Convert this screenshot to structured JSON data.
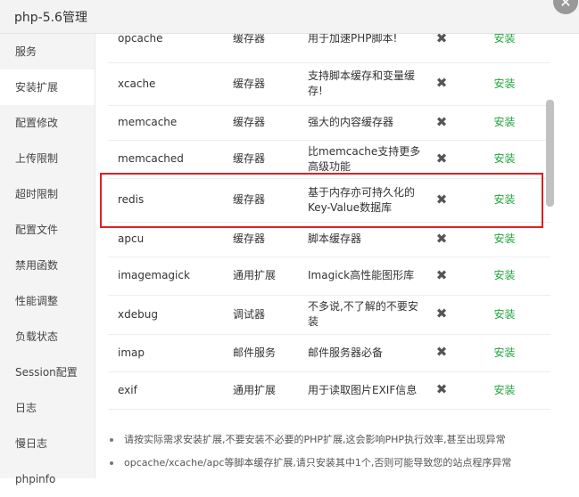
{
  "window": {
    "title": "php-5.6管理",
    "close_icon": "close-icon"
  },
  "sidebar": {
    "items": [
      {
        "label": "服务",
        "active": false
      },
      {
        "label": "安装扩展",
        "active": true
      },
      {
        "label": "配置修改",
        "active": false
      },
      {
        "label": "上传限制",
        "active": false
      },
      {
        "label": "超时限制",
        "active": false
      },
      {
        "label": "配置文件",
        "active": false
      },
      {
        "label": "禁用函数",
        "active": false
      },
      {
        "label": "性能调整",
        "active": false
      },
      {
        "label": "负载状态",
        "active": false
      },
      {
        "label": "Session配置",
        "active": false
      },
      {
        "label": "日志",
        "active": false
      },
      {
        "label": "慢日志",
        "active": false
      },
      {
        "label": "phpinfo",
        "active": false
      }
    ]
  },
  "extensions": [
    {
      "name": "opcache",
      "type": "缓存器",
      "desc": "用于加速PHP脚本!",
      "status": "✖",
      "action": "安装"
    },
    {
      "name": "xcache",
      "type": "缓存器",
      "desc": "支持脚本缓存和变量缓存!",
      "status": "✖",
      "action": "安装"
    },
    {
      "name": "memcache",
      "type": "缓存器",
      "desc": "强大的内容缓存器",
      "status": "✖",
      "action": "安装"
    },
    {
      "name": "memcached",
      "type": "缓存器",
      "desc": "比memcache支持更多高级功能",
      "status": "✖",
      "action": "安装"
    },
    {
      "name": "redis",
      "type": "缓存器",
      "desc": "基于内存亦可持久化的Key-Value数据库",
      "status": "✖",
      "action": "安装"
    },
    {
      "name": "apcu",
      "type": "缓存器",
      "desc": "脚本缓存器",
      "status": "✖",
      "action": "安装"
    },
    {
      "name": "imagemagick",
      "type": "通用扩展",
      "desc": "Imagick高性能图形库",
      "status": "✖",
      "action": "安装"
    },
    {
      "name": "xdebug",
      "type": "调试器",
      "desc": "不多说,不了解的不要安装",
      "status": "✖",
      "action": "安装"
    },
    {
      "name": "imap",
      "type": "邮件服务",
      "desc": "邮件服务器必备",
      "status": "✖",
      "action": "安装"
    },
    {
      "name": "exif",
      "type": "通用扩展",
      "desc": "用于读取图片EXIF信息",
      "status": "✖",
      "action": "安装"
    },
    {
      "name": "",
      "type": "",
      "desc": "",
      "status": "",
      "action": ""
    }
  ],
  "notes": [
    "请按实际需求安装扩展,不要安装不必要的PHP扩展,这会影响PHP执行效率,甚至出现异常",
    "opcache/xcache/apc等脚本缓存扩展,请只安装其中1个,否则可能导致您的站点程序异常"
  ],
  "highlighted_row": "redis",
  "colors": {
    "install_green": "#20a53a",
    "highlight_red": "#e02020",
    "sidebar_bg": "#f4f4f4"
  }
}
